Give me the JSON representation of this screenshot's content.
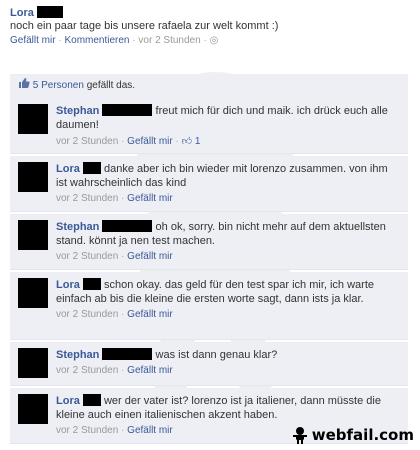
{
  "post": {
    "author": "Lora",
    "text": "noch ein paar tage bis unsere rafaela zur welt kommt :)",
    "like_label": "Gefällt mir",
    "comment_label": "Kommentieren",
    "time": "vor 2 Stunden"
  },
  "likes": {
    "count_text": "5 Personen",
    "suffix": "gefällt das."
  },
  "comments": [
    {
      "author": "Stephan",
      "text": "freut mich für dich und maik. ich drück euch alle daumen!",
      "time": "vor 2 Stunden",
      "like_label": "Gefällt mir",
      "like_count": "1"
    },
    {
      "author": "Lora",
      "text": "danke aber ich bin wieder mit lorenzo zusammen. von ihm ist wahrscheinlich das kind",
      "time": "vor 2 Stunden",
      "like_label": "Gefällt mir"
    },
    {
      "author": "Stephan",
      "text": "oh ok, sorry. bin nicht mehr auf dem aktuellsten stand. könnt ja nen test machen.",
      "time": "vor 2 Stunden",
      "like_label": "Gefällt mir"
    },
    {
      "author": "Lora",
      "text": "schon okay. das geld für den test spar ich mir, ich warte einfach ab bis die kleine die ersten worte sagt, dann ists ja klar.",
      "time": "vor 2 Stunden",
      "like_label": "Gefällt mir"
    },
    {
      "author": "Stephan",
      "text": "was ist dann genau klar?",
      "time": "vor 2 Stunden",
      "like_label": "Gefällt mir"
    },
    {
      "author": "Lora",
      "text": "wer der vater ist? lorenzo ist ja italiener, dann müsste die kleine auch einen italienischen akzent haben.",
      "time": "vor 2 Stunden",
      "like_label": "Gefällt mir"
    }
  ],
  "watermark": {
    "brand": "webfail.com"
  },
  "colors": {
    "link": "#3b5998",
    "comment_bg": "#edeff4",
    "meta": "#999999"
  }
}
